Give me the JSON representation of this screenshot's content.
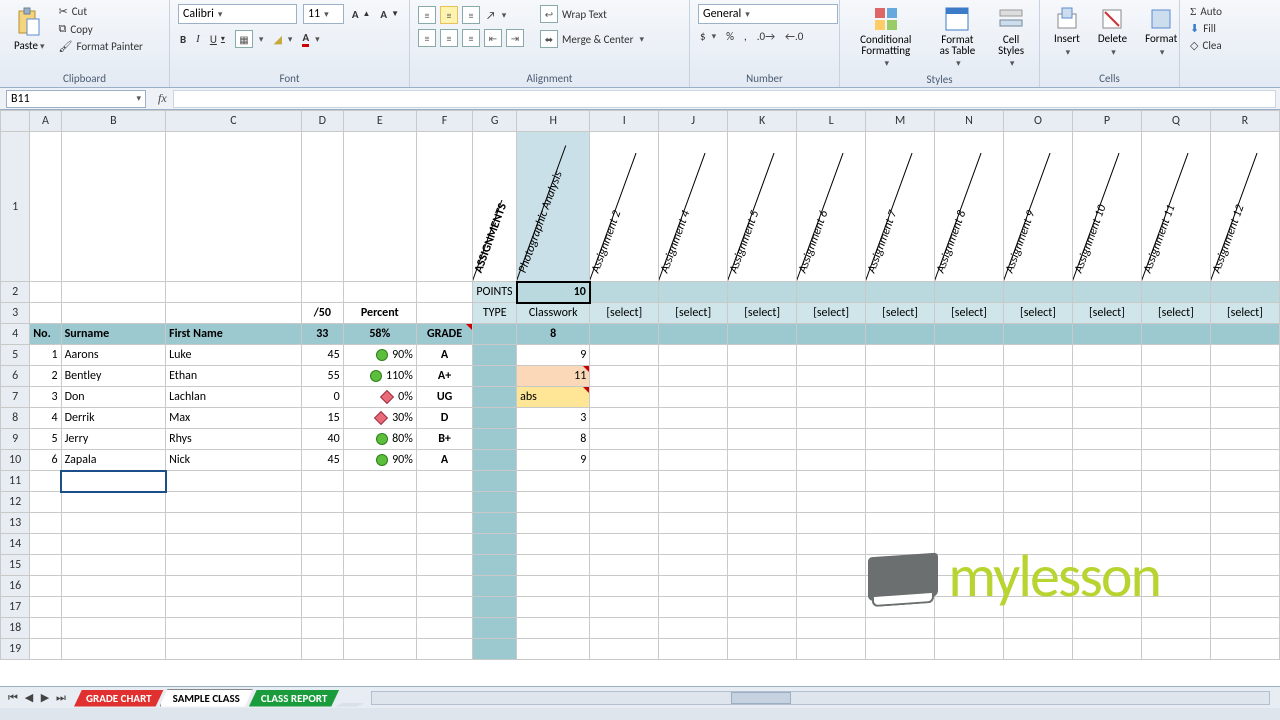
{
  "ribbon": {
    "paste": "Paste",
    "cut": "Cut",
    "copy": "Copy",
    "painter": "Format Painter",
    "clipboard_title": "Clipboard",
    "font_name": "Calibri",
    "font_size": "11",
    "font_title": "Font",
    "wrap": "Wrap Text",
    "merge": "Merge & Center",
    "align_title": "Alignment",
    "num_format": "General",
    "num_title": "Number",
    "cond": "Conditional Formatting",
    "as_table": "Format as Table",
    "cell_styles": "Cell Styles",
    "styles_title": "Styles",
    "insert": "Insert",
    "delete": "Delete",
    "format": "Format",
    "cells_title": "Cells",
    "autosum": "Auto",
    "fill": "Fill",
    "clear": "Clea"
  },
  "name_box": "B11",
  "columns": [
    "A",
    "B",
    "C",
    "D",
    "E",
    "F",
    "G",
    "H",
    "I",
    "J",
    "K",
    "L",
    "M",
    "N",
    "O",
    "P",
    "Q",
    "R"
  ],
  "diag_headers": {
    "G": "ASSIGNMENTS",
    "H": "Photographic Analysis",
    "I": "Assignment 2",
    "J": "Assignment 4",
    "K": "Assignment 5",
    "L": "Assignment 6",
    "M": "Assignment 7",
    "N": "Assignment 8",
    "O": "Assignment 9",
    "P": "Assignment 10",
    "Q": "Assignment 11",
    "R": "Assignment 12"
  },
  "row2": {
    "G": "POINTS",
    "H": "10"
  },
  "row3": {
    "D": "/50",
    "E": "Percent",
    "G": "TYPE",
    "H": "Classwork",
    "I": "[select]",
    "J": "[select]",
    "K": "[select]",
    "L": "[select]",
    "M": "[select]",
    "N": "[select]",
    "O": "[select]",
    "P": "[select]",
    "Q": "[select]",
    "R": "[select]"
  },
  "row4": {
    "A": "No.",
    "B": "Surname",
    "C": "First Name",
    "D": "33",
    "E": "58%",
    "F": "GRADE",
    "H": "8"
  },
  "students": [
    {
      "no": "1",
      "surname": "Aarons",
      "first": "Luke",
      "score": "45",
      "ind": "g",
      "pct": "90%",
      "grade": "A",
      "h": "9"
    },
    {
      "no": "2",
      "surname": "Bentley",
      "first": "Ethan",
      "score": "55",
      "ind": "g",
      "pct": "110%",
      "grade": "A+",
      "h": "11",
      "hstyle": "peach"
    },
    {
      "no": "3",
      "surname": "Don",
      "first": "Lachlan",
      "score": "0",
      "ind": "r",
      "pct": "0%",
      "grade": "UG",
      "h": "abs",
      "hstyle": "yellow"
    },
    {
      "no": "4",
      "surname": "Derrik",
      "first": "Max",
      "score": "15",
      "ind": "r",
      "pct": "30%",
      "grade": "D",
      "h": "3"
    },
    {
      "no": "5",
      "surname": "Jerry",
      "first": "Rhys",
      "score": "40",
      "ind": "g",
      "pct": "80%",
      "grade": "B+",
      "h": "8"
    },
    {
      "no": "6",
      "surname": "Zapala",
      "first": "Nick",
      "score": "45",
      "ind": "g",
      "pct": "90%",
      "grade": "A",
      "h": "9"
    }
  ],
  "sheet_tabs": {
    "t1": "GRADE CHART",
    "t2": "SAMPLE CLASS",
    "t3": "CLASS REPORT"
  },
  "watermark": "mylesson"
}
